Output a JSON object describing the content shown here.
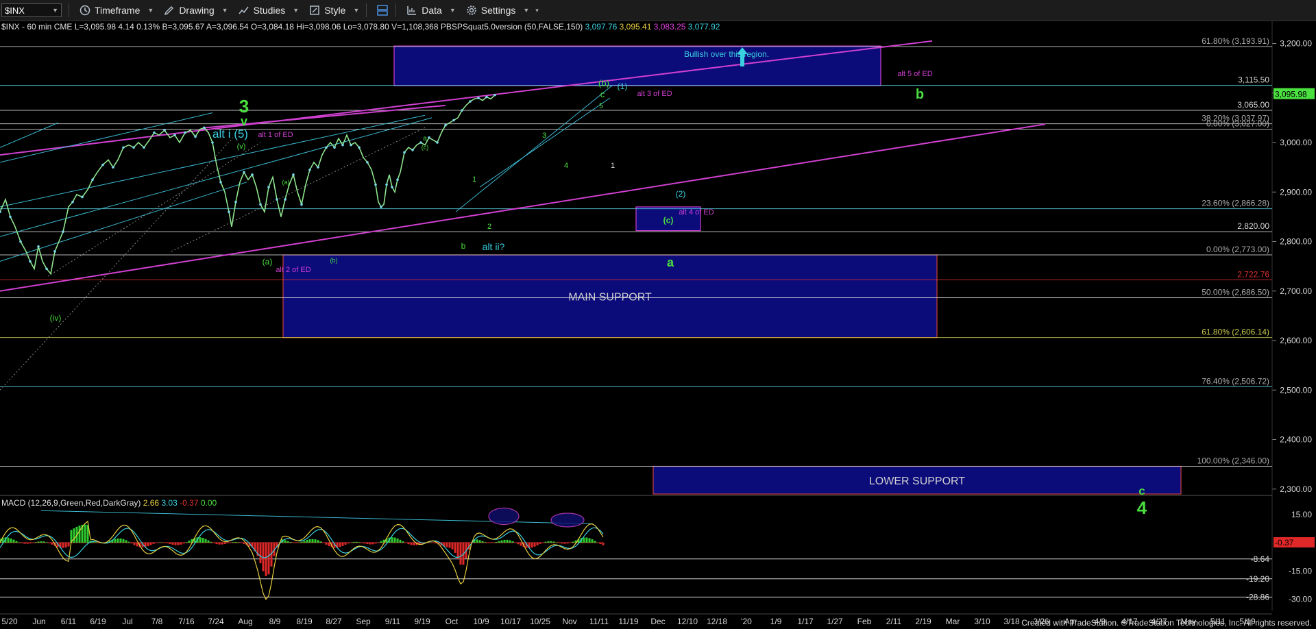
{
  "toolbar": {
    "symbol": "$INX",
    "timeframe_label": "Timeframe",
    "drawing_label": "Drawing",
    "studies_label": "Studies",
    "style_label": "Style",
    "data_label": "Data",
    "settings_label": "Settings"
  },
  "header": {
    "info": "$INX - 60 min CME L=3,095.98 4.14 0.13% B=3,095.67 A=3,096.54 O=3,084.18 Hi=3,098.06 Lo=3,078.80 V=1,108,368 PBSPSquat5.0version (50,FALSE,150)",
    "v1": "3,097.76",
    "v2": "3,095.41",
    "v3": "3,083.25",
    "v4": "3,077.92",
    "v1_color": "#3ad0e0",
    "v2_color": "#e8d040",
    "v3_color": "#e040e0",
    "v4_color": "#3ad0e0"
  },
  "footer": "Created with TradeStation. ©TradeStation Technologies, Inc. All rights reserved.",
  "chart_data": {
    "type": "line",
    "series_name": "$INX - 60 min",
    "y_ticks": [
      2300,
      2400,
      2500,
      2600,
      2700,
      2800,
      2900,
      3000,
      3100,
      3200
    ],
    "y_tick_labels": [
      "2,300.00",
      "2,400.00",
      "2,500.00",
      "2,600.00",
      "2,700.00",
      "2,800.00",
      "2,900.00",
      "3,000.00",
      "3,100.00",
      "3,200.00"
    ],
    "ylim": [
      2290,
      3245
    ],
    "x_labels": [
      "5/20",
      "Jun",
      "6/11",
      "6/19",
      "Jul",
      "7/8",
      "7/16",
      "7/24",
      "Aug",
      "8/9",
      "8/19",
      "8/27",
      "Sep",
      "9/11",
      "9/19",
      "Oct",
      "10/9",
      "10/17",
      "10/25",
      "Nov",
      "11/11",
      "11/19",
      "Dec",
      "12/10",
      "12/18",
      "'20",
      "1/9",
      "1/17",
      "1/27",
      "Feb",
      "2/11",
      "2/19",
      "Mar",
      "3/10",
      "3/18",
      "3/26",
      "Apr",
      "4/9",
      "4/17",
      "4/27",
      "May",
      "5/11",
      "5/19"
    ],
    "price": [
      [
        0,
        2860
      ],
      [
        8,
        2885
      ],
      [
        15,
        2850
      ],
      [
        22,
        2830
      ],
      [
        30,
        2800
      ],
      [
        38,
        2780
      ],
      [
        44,
        2760
      ],
      [
        50,
        2745
      ],
      [
        56,
        2790
      ],
      [
        62,
        2760
      ],
      [
        68,
        2745
      ],
      [
        74,
        2735
      ],
      [
        80,
        2780
      ],
      [
        86,
        2800
      ],
      [
        92,
        2820
      ],
      [
        100,
        2870
      ],
      [
        106,
        2880
      ],
      [
        112,
        2895
      ],
      [
        120,
        2890
      ],
      [
        128,
        2905
      ],
      [
        135,
        2925
      ],
      [
        142,
        2940
      ],
      [
        150,
        2955
      ],
      [
        158,
        2965
      ],
      [
        165,
        2950
      ],
      [
        172,
        2965
      ],
      [
        180,
        2990
      ],
      [
        188,
        2995
      ],
      [
        195,
        2990
      ],
      [
        202,
        3000
      ],
      [
        210,
        2990
      ],
      [
        218,
        3005
      ],
      [
        225,
        3020
      ],
      [
        232,
        3015
      ],
      [
        240,
        3025
      ],
      [
        248,
        3010
      ],
      [
        255,
        3015
      ],
      [
        262,
        3000
      ],
      [
        270,
        3020
      ],
      [
        278,
        3025
      ],
      [
        285,
        3012
      ],
      [
        292,
        3027
      ],
      [
        298,
        3030
      ],
      [
        304,
        3020
      ],
      [
        310,
        3000
      ],
      [
        316,
        2955
      ],
      [
        322,
        2920
      ],
      [
        328,
        2900
      ],
      [
        334,
        2860
      ],
      [
        338,
        2830
      ],
      [
        344,
        2880
      ],
      [
        350,
        2920
      ],
      [
        356,
        2940
      ],
      [
        362,
        2925
      ],
      [
        368,
        2935
      ],
      [
        374,
        2910
      ],
      [
        380,
        2875
      ],
      [
        386,
        2860
      ],
      [
        392,
        2910
      ],
      [
        398,
        2930
      ],
      [
        404,
        2885
      ],
      [
        410,
        2850
      ],
      [
        416,
        2885
      ],
      [
        422,
        2915
      ],
      [
        428,
        2935
      ],
      [
        434,
        2900
      ],
      [
        440,
        2875
      ],
      [
        446,
        2915
      ],
      [
        452,
        2945
      ],
      [
        458,
        2960
      ],
      [
        464,
        2950
      ],
      [
        470,
        2975
      ],
      [
        476,
        2990
      ],
      [
        482,
        3000
      ],
      [
        488,
        2990
      ],
      [
        494,
        3008
      ],
      [
        500,
        2995
      ],
      [
        506,
        3015
      ],
      [
        512,
        2995
      ],
      [
        518,
        3000
      ],
      [
        524,
        2990
      ],
      [
        530,
        2970
      ],
      [
        536,
        2960
      ],
      [
        542,
        2945
      ],
      [
        548,
        2915
      ],
      [
        552,
        2880
      ],
      [
        556,
        2870
      ],
      [
        560,
        2875
      ],
      [
        564,
        2915
      ],
      [
        568,
        2935
      ],
      [
        572,
        2910
      ],
      [
        576,
        2900
      ],
      [
        580,
        2925
      ],
      [
        584,
        2940
      ],
      [
        590,
        2980
      ],
      [
        596,
        2990
      ],
      [
        602,
        2985
      ],
      [
        608,
        2995
      ],
      [
        614,
        3000
      ],
      [
        620,
        2995
      ],
      [
        626,
        3010
      ],
      [
        632,
        3005
      ],
      [
        638,
        3000
      ],
      [
        644,
        3020
      ],
      [
        650,
        3035
      ],
      [
        656,
        3040
      ],
      [
        662,
        3045
      ],
      [
        668,
        3050
      ],
      [
        674,
        3065
      ],
      [
        680,
        3075
      ],
      [
        686,
        3083
      ],
      [
        692,
        3088
      ],
      [
        698,
        3090
      ],
      [
        704,
        3085
      ],
      [
        710,
        3092
      ],
      [
        716,
        3088
      ],
      [
        722,
        3096
      ]
    ],
    "levels": [
      {
        "label": "61.80% (3,193.91)",
        "y": 3193.91,
        "color": "#c8c8c8",
        "text_color": "#aaa"
      },
      {
        "label": "3,115.50",
        "y": 3115.5,
        "color": "#5ad0e0",
        "text_color": "#d8d8d8"
      },
      {
        "label": "3,065.00",
        "y": 3065.0,
        "color": "#d8d8d8",
        "text_color": "#d8d8d8"
      },
      {
        "label": "38.20% (3,037.97)",
        "y": 3037.97,
        "color": "#d8d8d8",
        "text_color": "#aaa"
      },
      {
        "label": "0.00% (3,027.00)",
        "y": 3027.0,
        "color": "#d8d8d8",
        "text_color": "#aaa"
      },
      {
        "label": "23.60% (2,866.28)",
        "y": 2866.28,
        "color": "#5ad0e0",
        "text_color": "#aaa"
      },
      {
        "label": "2,820.00",
        "y": 2820.0,
        "color": "#d8d8d8",
        "text_color": "#d8d8d8"
      },
      {
        "label": "0.00% (2,773.00)",
        "y": 2773.0,
        "color": "#d8d8d8",
        "text_color": "#aaa"
      },
      {
        "label": "2,722.76",
        "y": 2722.76,
        "color": "#e03030",
        "text_color": "#e03030"
      },
      {
        "label": "50.00% (2,686.50)",
        "y": 2686.5,
        "color": "#d8d8d8",
        "text_color": "#aaa"
      },
      {
        "label": "61.80% (2,606.14)",
        "y": 2606.14,
        "color": "#c8c850",
        "text_color": "#c8c850"
      },
      {
        "label": "76.40% (2,506.72)",
        "y": 2506.72,
        "color": "#5ad0e0",
        "text_color": "#aaa"
      },
      {
        "label": "100.00% (2,346.00)",
        "y": 2346.0,
        "color": "#d8d8d8",
        "text_color": "#aaa"
      }
    ],
    "last_price_label": "3,095.98",
    "boxes": [
      {
        "y1": 3195,
        "y2": 3115,
        "label": "Bullish over this region.",
        "label_color": "#3ad0e0",
        "fill": "#0b0b7a",
        "stroke": "#d040d0"
      },
      {
        "y1": 2870,
        "y2": 2822,
        "label": "(c)",
        "label_color": "#4ae040",
        "fill": "#0b0b7a",
        "stroke": "#d040d0"
      },
      {
        "y1": 2773,
        "y2": 2606,
        "label": "MAIN SUPPORT",
        "label_color": "#d0d0d0",
        "fill": "#0b0b7a",
        "stroke": "#d04040"
      },
      {
        "y1": 2346,
        "y2": 2287,
        "label": "LOWER SUPPORT",
        "label_color": "#d0d0d0",
        "fill": "#0b0b7a",
        "stroke": "#d04040"
      }
    ],
    "annotations": [
      {
        "text": "3",
        "color": "#4ae040",
        "size": 26,
        "bold": true
      },
      {
        "text": "v",
        "color": "#4ae040",
        "size": 18,
        "bold": true
      },
      {
        "text": "alt i (5)",
        "color": "#3ad0e0",
        "size": 17
      },
      {
        "text": "alt 1 of ED",
        "color": "#d040d0",
        "size": 11
      },
      {
        "text": "(v)",
        "color": "#4ae040",
        "size": 11
      },
      {
        "text": "(iv)",
        "color": "#4ae040",
        "size": 12
      },
      {
        "text": "(a)",
        "color": "#4ae040",
        "size": 12
      },
      {
        "text": "(a)",
        "color": "#4ae040",
        "size": 9
      },
      {
        "text": "(b)",
        "color": "#4ae040",
        "size": 9
      },
      {
        "text": "alt 2 of ED",
        "color": "#d040d0",
        "size": 11
      },
      {
        "text": "a",
        "color": "#4ae040",
        "size": 10
      },
      {
        "text": "(c)",
        "color": "#4ae040",
        "size": 9
      },
      {
        "text": "b",
        "color": "#4ae040",
        "size": 12
      },
      {
        "text": "alt ii?",
        "color": "#3ad0e0",
        "size": 14
      },
      {
        "text": "1",
        "color": "#4ae040",
        "size": 11
      },
      {
        "text": "2",
        "color": "#4ae040",
        "size": 11
      },
      {
        "text": "3",
        "color": "#4ae040",
        "size": 11
      },
      {
        "text": "4",
        "color": "#4ae040",
        "size": 11
      },
      {
        "text": "(b)",
        "color": "#4ae040",
        "size": 13
      },
      {
        "text": "c",
        "color": "#4ae040",
        "size": 13
      },
      {
        "text": "5",
        "color": "#4ae040",
        "size": 11
      },
      {
        "text": "(1)",
        "color": "#3ad0e0",
        "size": 12
      },
      {
        "text": "alt 3 of ED",
        "color": "#d040d0",
        "size": 11
      },
      {
        "text": "1",
        "color": "#d8d8d8",
        "size": 11
      },
      {
        "text": "(2)",
        "color": "#3ad0e0",
        "size": 12
      },
      {
        "text": "alt 4 of ED",
        "color": "#d040d0",
        "size": 11
      },
      {
        "text": "a",
        "color": "#4ae040",
        "size": 18,
        "bold": true
      },
      {
        "text": "alt 5 of ED",
        "color": "#d040d0",
        "size": 11
      },
      {
        "text": "b",
        "color": "#4ae040",
        "size": 20,
        "bold": true
      },
      {
        "text": "c",
        "color": "#4ae040",
        "size": 17,
        "bold": true
      },
      {
        "text": "4",
        "color": "#4ae040",
        "size": 26,
        "bold": true
      }
    ],
    "macd": {
      "label": "MACD (12,26,9,Green,Red,DarkGray)",
      "v1": "2.66",
      "v2": "3.03",
      "v3": "-0.37",
      "v4": "0.00",
      "v1_color": "#e8d040",
      "v2_color": "#3ad0e0",
      "v3_color": "#e03030",
      "v4_color": "#4ae040",
      "y_ticks": [
        15,
        -15,
        -30
      ],
      "y_tick_labels": [
        "15.00",
        "-15.00",
        "-30.00"
      ],
      "ylim": [
        -36,
        24
      ],
      "levels": [
        {
          "label": "-8.64",
          "y": -8.64,
          "color": "#d8d8d8"
        },
        {
          "label": "-19.20",
          "y": -19.2,
          "color": "#d8d8d8"
        },
        {
          "label": "-28.86",
          "y": -28.86,
          "color": "#d8d8d8"
        }
      ],
      "last_label": "-0.37"
    }
  }
}
